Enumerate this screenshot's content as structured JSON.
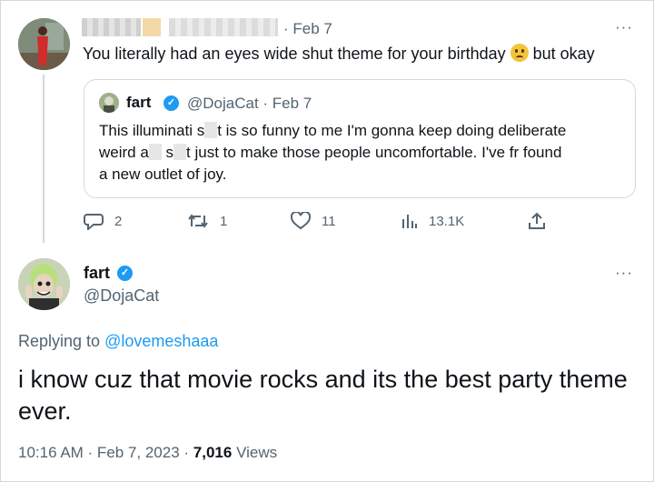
{
  "reply_tweet": {
    "date": "· Feb 7",
    "more_label": "···",
    "text": "You literally had an eyes wide shut theme for your birthday",
    "text_after_emoji": "but okay",
    "emoji_icon": "worried-face-emoji"
  },
  "quoted_tweet": {
    "name": "fart",
    "handle_date": "@DojaCat · Feb 7",
    "text_parts": [
      "This illuminati s",
      "t is so funny to me I'm gonna keep doing deliberate",
      "weird a",
      "s",
      "t just to make those people uncomfortable. I've fr found",
      "a new outlet of joy."
    ]
  },
  "actions": {
    "reply_count": "2",
    "retweet_count": "1",
    "like_count": "11",
    "views_count": "13.1K"
  },
  "main_tweet": {
    "name": "fart",
    "handle": "@DojaCat",
    "more_label": "···",
    "replying_prefix": "Replying to",
    "replying_to": "@lovemeshaaa",
    "text": "i know cuz that movie rocks and its the best party theme ever.",
    "time_date": "10:16 AM · Feb 7, 2023 ·",
    "views_number": "7,016",
    "views_label": "Views"
  },
  "colors": {
    "accent": "#1d9bf0",
    "secondary_text": "#536471",
    "border": "#cfd9de"
  }
}
